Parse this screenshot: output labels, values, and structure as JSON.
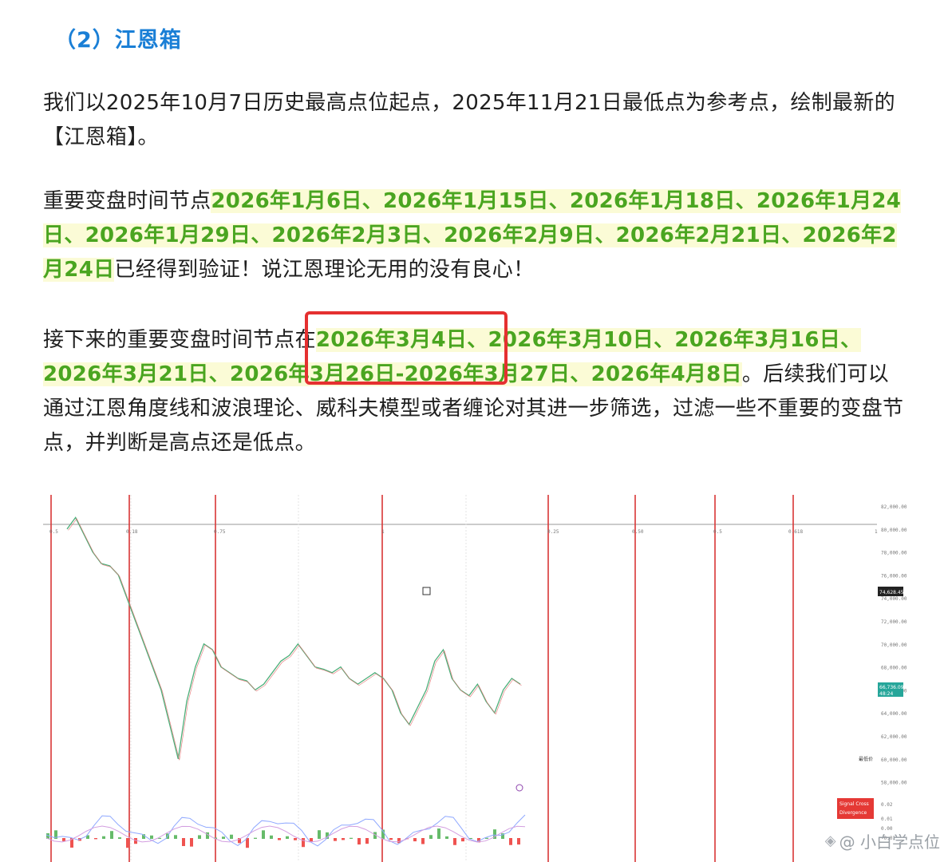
{
  "heading": "（2）江恩箱",
  "para1": "我们以2025年10月7日历史最高点位起点，2025年11月21日最低点为参考点，绘制最新的【江恩箱】。",
  "para2": {
    "prefix": "重要变盘时间节点",
    "highlight": "2026年1月6日、2026年1月15日、2026年1月18日、2026年1月24日、2026年1月29日、2026年2月3日、2026年2月9日、2026年2月21日、2026年2月24日",
    "suffix": "已经得到验证！说江恩理论无用的没有良心！"
  },
  "para3": {
    "prefix": "接下来的重要变盘时间节点在",
    "highlight": "2026年3月4日、2026年3月10日、2026年3月16日、2026年3月21日、2026年3月26日-2026年3月27日、2026年4月8日",
    "suffix": "。后续我们可以通过江恩角度线和波浪理论、威科夫模型或者缠论对其进一步筛选，过滤一些不重要的变盘节点，并判断是高点还是低点。"
  },
  "chart_data": {
    "type": "line",
    "y_ticks": [
      "82,000.00",
      "80,000.00",
      "78,000.00",
      "76,000.00",
      "74,000.00",
      "72,000.00",
      "70,000.00",
      "68,000.00",
      "66,000.00",
      "64,000.00",
      "62,000.00",
      "60,000.00",
      "58,000.00"
    ],
    "ylim": [
      57000,
      83000
    ],
    "top_scale_labels": [
      "0.5",
      "0.18",
      "0.75",
      "1",
      "0.25",
      "0.50",
      "0.5",
      "0.618",
      "1"
    ],
    "last_price_label": "74,628.45",
    "current_price_label": "66,736.09",
    "current_price_sub": "48:24",
    "lowest_price_label": "最低价",
    "signal_labels": [
      "Signal Cross",
      "Divergence"
    ],
    "osc_ticks": [
      "0.02",
      "0.01",
      "0.00",
      "-0.01"
    ],
    "price_series": [
      80000,
      81000,
      79500,
      78000,
      77000,
      76800,
      76000,
      74000,
      72000,
      70000,
      68000,
      66000,
      63000,
      60000,
      65000,
      68000,
      70000,
      69500,
      68000,
      67500,
      67000,
      66800,
      66000,
      66500,
      67500,
      68500,
      69000,
      70000,
      69000,
      68000,
      67800,
      67500,
      68000,
      67000,
      66500,
      67000,
      67500,
      67000,
      66000,
      64000,
      63000,
      64500,
      66000,
      68500,
      69500,
      67000,
      66000,
      65500,
      66500,
      65000,
      64000,
      66000,
      67000,
      66500
    ]
  },
  "watermark": "@ 小白学点位"
}
